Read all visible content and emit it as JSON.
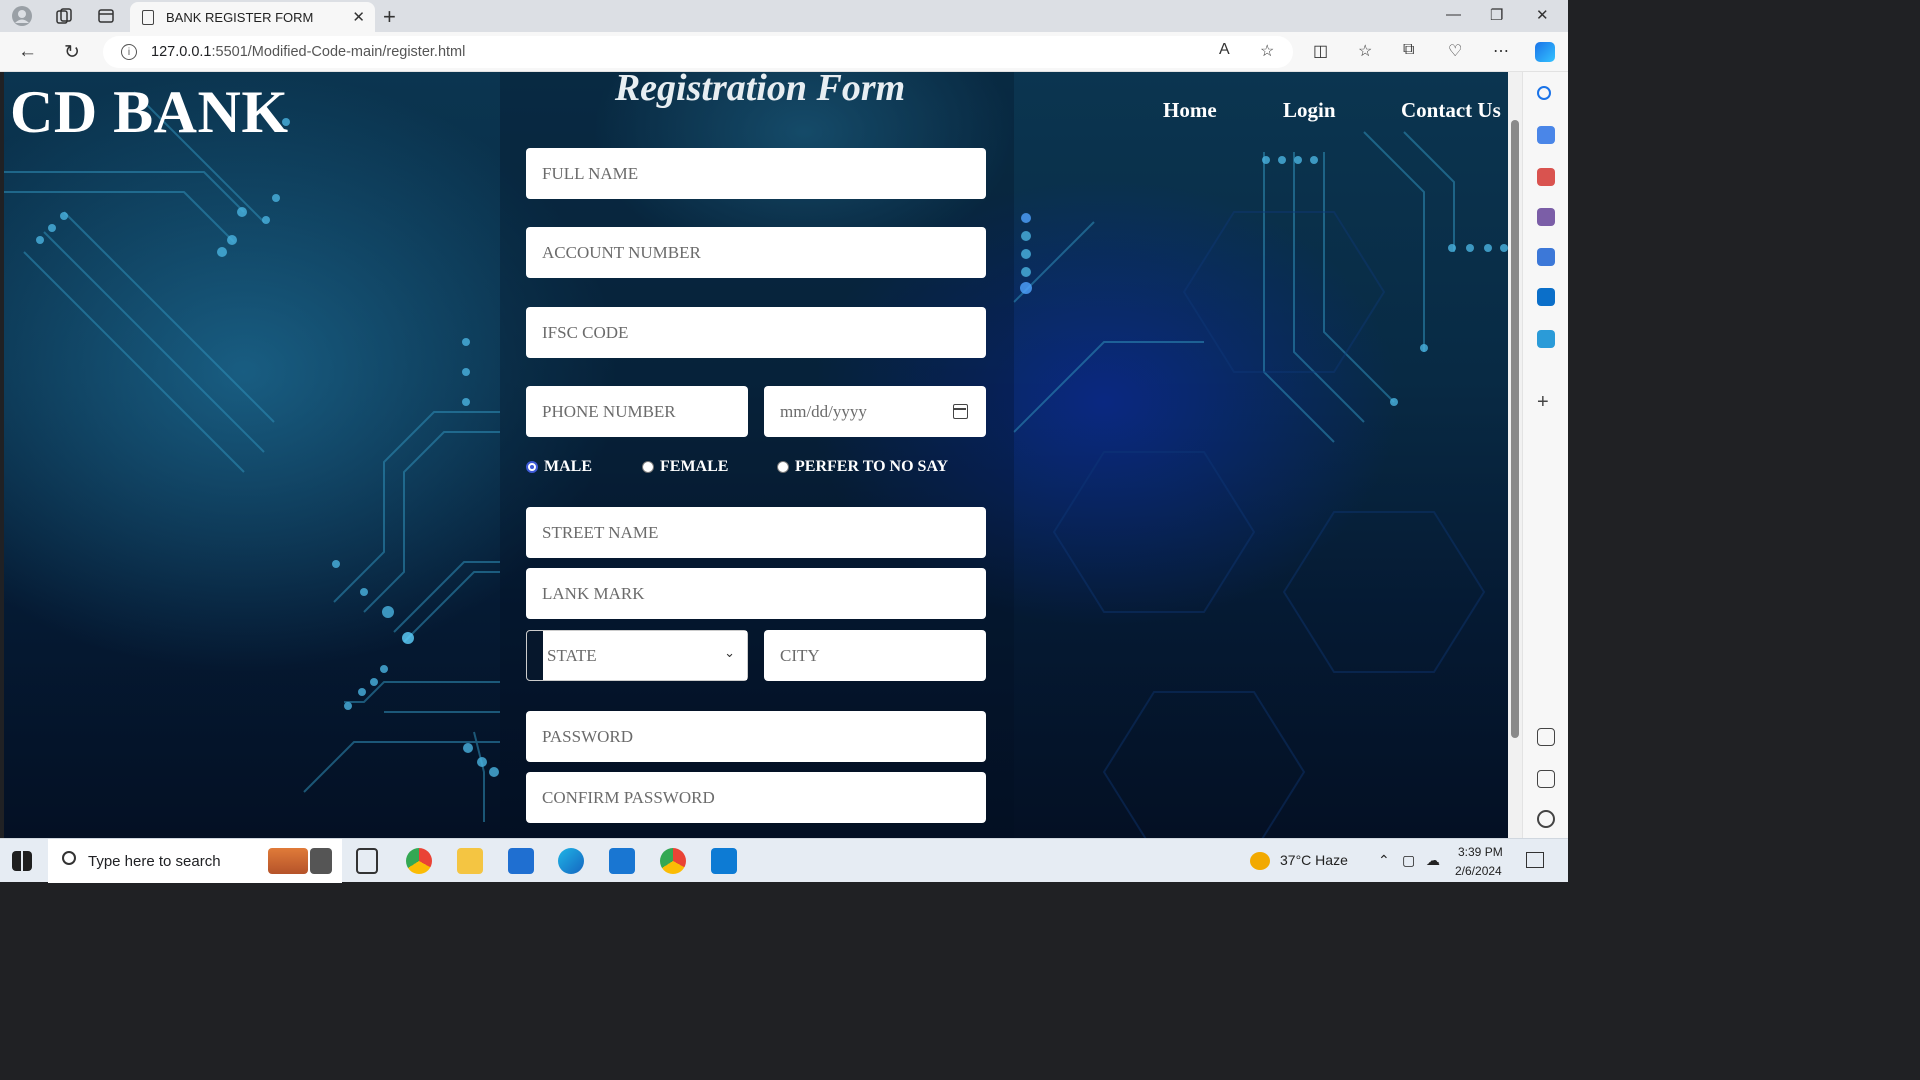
{
  "browser": {
    "tab_title": "BANK REGISTER FORM",
    "url_host": "127.0.0.1",
    "url_path": ":5501/Modified-Code-main/register.html"
  },
  "page": {
    "brand": "CD BANK",
    "form_title": "Registration Form",
    "nav": [
      "Home",
      "Login",
      "Contact Us"
    ],
    "fields": {
      "full_name": "FULL NAME",
      "account_number": "ACCOUNT NUMBER",
      "ifsc_code": "IFSC CODE",
      "phone_number": "PHONE NUMBER",
      "dob": "mm/dd/yyyy",
      "street_name": "STREET NAME",
      "land_mark": "LANK MARK",
      "state": "STATE",
      "city": "CITY",
      "password": "PASSWORD",
      "confirm_password": "CONFIRM PASSWORD"
    },
    "gender": {
      "options": [
        "MALE",
        "FEMALE",
        "PERFER TO NO SAY"
      ],
      "selected": "MALE"
    }
  },
  "taskbar": {
    "search_placeholder": "Type here to search",
    "weather": "37°C  Haze",
    "time": "3:39 PM",
    "date": "2/6/2024"
  },
  "colors": {
    "radio_accent": "#3f5bd8",
    "edge_accent": "#1a73e8"
  }
}
